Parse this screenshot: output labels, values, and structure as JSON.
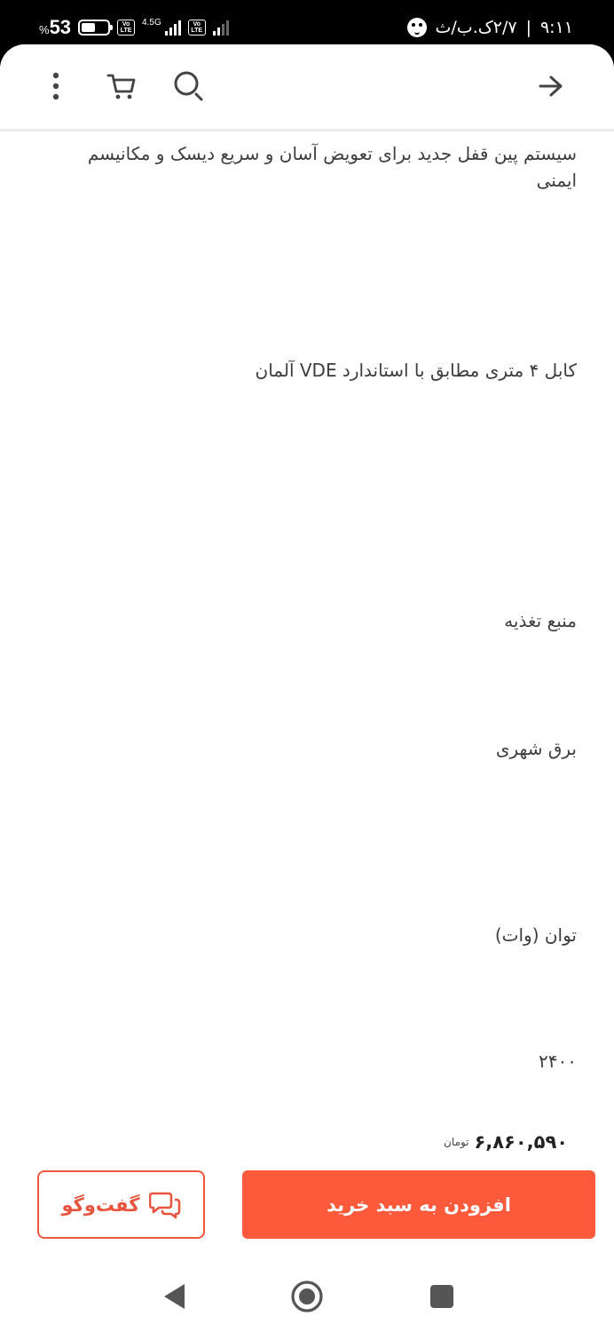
{
  "status_bar": {
    "battery_percent": "53",
    "percent_sign": "%",
    "battery_level": 0.53,
    "volte_top": "Vo",
    "volte_bottom": "LTE",
    "network_type": "4.5G",
    "time": "۹:۱۱",
    "separator": "|",
    "data_rate": "۲/۷ک.ب/ث"
  },
  "toolbar": {
    "back_icon": "arrow-right-icon",
    "search_icon": "search-icon",
    "cart_icon": "cart-icon",
    "more_icon": "more-vertical-icon"
  },
  "specs": {
    "line_1": "سیستم پین قفل جدید برای تعویض آسان و سریع دیسک و مکانیسم ایمنی",
    "line_2": "کابل ۴ متری مطابق با استاندارد VDE آلمان",
    "label_power_source": "منبع تغذیه",
    "value_power_source": "برق شهری",
    "label_power_watt": "توان (وات)",
    "value_power_watt": "۲۴۰۰"
  },
  "price": {
    "amount": "۶,۸۶۰,۵۹۰",
    "currency": "تومان"
  },
  "actions": {
    "add_to_cart": "افزودن به سبد خرید",
    "chat": "گفت‌وگو"
  },
  "colors": {
    "accent": "#fd5a3b",
    "accent_border": "#f0573f",
    "text": "#3d3d3d"
  }
}
